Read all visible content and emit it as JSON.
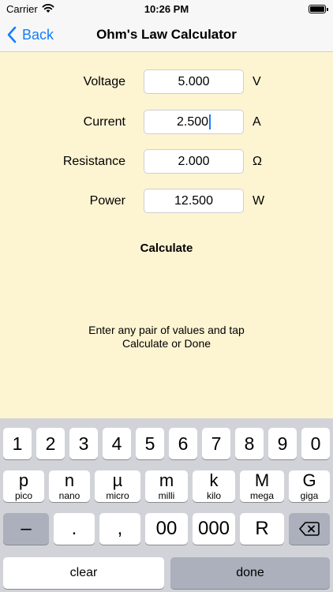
{
  "status_bar": {
    "carrier": "Carrier",
    "time": "10:26 PM"
  },
  "nav": {
    "back_label": "Back",
    "title": "Ohm's Law Calculator"
  },
  "form": {
    "voltage": {
      "label": "Voltage",
      "value": "5.000",
      "unit": "V"
    },
    "current": {
      "label": "Current",
      "value": "2.500",
      "unit": "A"
    },
    "resistance": {
      "label": "Resistance",
      "value": "2.000",
      "unit": "Ω"
    },
    "power": {
      "label": "Power",
      "value": "12.500",
      "unit": "W"
    }
  },
  "calculate_label": "Calculate",
  "hint": {
    "line1": "Enter any pair of values and tap",
    "line2": "Calculate or Done"
  },
  "keyboard": {
    "digits": [
      "1",
      "2",
      "3",
      "4",
      "5",
      "6",
      "7",
      "8",
      "9",
      "0"
    ],
    "prefixes": [
      {
        "symbol": "p",
        "name": "pico"
      },
      {
        "symbol": "n",
        "name": "nano"
      },
      {
        "symbol": "µ",
        "name": "micro"
      },
      {
        "symbol": "m",
        "name": "milli"
      },
      {
        "symbol": "k",
        "name": "kilo"
      },
      {
        "symbol": "M",
        "name": "mega"
      },
      {
        "symbol": "G",
        "name": "giga"
      }
    ],
    "row3": {
      "minus": "–",
      "dot": ".",
      "comma": ",",
      "double_zero": "00",
      "triple_zero": "000",
      "r": "R"
    },
    "clear_label": "clear",
    "done_label": "done"
  },
  "colors": {
    "accent": "#147efb",
    "background": "#fdf4d2",
    "keyboard": "#d1d3d9"
  }
}
